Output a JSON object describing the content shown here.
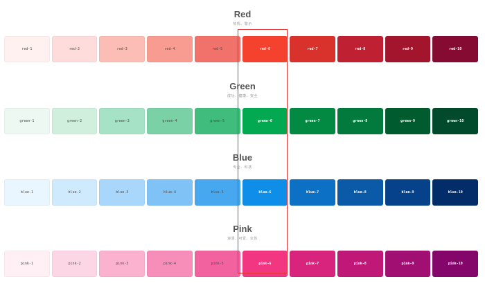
{
  "palettes": [
    {
      "title": "Red",
      "subtitle": "热情、警示",
      "swatches": [
        {
          "label": "red-1",
          "color": "#fff1f0",
          "tone": "light"
        },
        {
          "label": "red-2",
          "color": "#fddcdb",
          "tone": "light"
        },
        {
          "label": "red-3",
          "color": "#fcbdb6",
          "tone": "light"
        },
        {
          "label": "red-4",
          "color": "#f89b90",
          "tone": "light"
        },
        {
          "label": "red-5",
          "color": "#f1716b",
          "tone": "light"
        },
        {
          "label": "red-6",
          "color": "#f5422f",
          "tone": "dark"
        },
        {
          "label": "red-7",
          "color": "#d9322d",
          "tone": "dark"
        },
        {
          "label": "red-8",
          "color": "#bf2132",
          "tone": "dark"
        },
        {
          "label": "red-9",
          "color": "#a3142d",
          "tone": "dark"
        },
        {
          "label": "red-10",
          "color": "#850b33",
          "tone": "dark"
        }
      ]
    },
    {
      "title": "Green",
      "subtitle": "成功、健康、安全",
      "swatches": [
        {
          "label": "green-1",
          "color": "#ecf8f1",
          "tone": "light"
        },
        {
          "label": "green-2",
          "color": "#d0efdd",
          "tone": "light"
        },
        {
          "label": "green-3",
          "color": "#a6e2c5",
          "tone": "light"
        },
        {
          "label": "green-4",
          "color": "#7ad1a6",
          "tone": "light"
        },
        {
          "label": "green-5",
          "color": "#40bd7c",
          "tone": "light"
        },
        {
          "label": "green-6",
          "color": "#02a950",
          "tone": "dark"
        },
        {
          "label": "green-7",
          "color": "#028a42",
          "tone": "dark"
        },
        {
          "label": "green-8",
          "color": "#037a3d",
          "tone": "dark"
        },
        {
          "label": "green-9",
          "color": "#005c2e",
          "tone": "dark"
        },
        {
          "label": "green-10",
          "color": "#014a2b",
          "tone": "dark"
        }
      ]
    },
    {
      "title": "Blue",
      "subtitle": "专业、科技",
      "swatches": [
        {
          "label": "blue-1",
          "color": "#eaf6ff",
          "tone": "light"
        },
        {
          "label": "blue-2",
          "color": "#cfe9fd",
          "tone": "light"
        },
        {
          "label": "blue-3",
          "color": "#a9d7fb",
          "tone": "light"
        },
        {
          "label": "blue-4",
          "color": "#7fc2f6",
          "tone": "light"
        },
        {
          "label": "blue-5",
          "color": "#47a8f0",
          "tone": "light"
        },
        {
          "label": "blue-6",
          "color": "#0f8ee9",
          "tone": "dark"
        },
        {
          "label": "blue-7",
          "color": "#0c70c5",
          "tone": "dark"
        },
        {
          "label": "blue-8",
          "color": "#0b5aa8",
          "tone": "dark"
        },
        {
          "label": "blue-9",
          "color": "#064289",
          "tone": "dark"
        },
        {
          "label": "blue-10",
          "color": "#032d68",
          "tone": "dark"
        }
      ]
    },
    {
      "title": "Pink",
      "subtitle": "浪漫、可爱、女性",
      "swatches": [
        {
          "label": "pink-1",
          "color": "#fff0f5",
          "tone": "light"
        },
        {
          "label": "pink-2",
          "color": "#fdd6e6",
          "tone": "light"
        },
        {
          "label": "pink-3",
          "color": "#fbb2cf",
          "tone": "light"
        },
        {
          "label": "pink-4",
          "color": "#f78eba",
          "tone": "light"
        },
        {
          "label": "pink-5",
          "color": "#f1629e",
          "tone": "light"
        },
        {
          "label": "pink-6",
          "color": "#f23681",
          "tone": "dark"
        },
        {
          "label": "pink-7",
          "color": "#d8247c",
          "tone": "dark"
        },
        {
          "label": "pink-8",
          "color": "#bf1877",
          "tone": "dark"
        },
        {
          "label": "pink-9",
          "color": "#a20f73",
          "tone": "dark"
        },
        {
          "label": "pink-10",
          "color": "#85066b",
          "tone": "dark"
        }
      ]
    }
  ],
  "highlight_color": "#e03131"
}
